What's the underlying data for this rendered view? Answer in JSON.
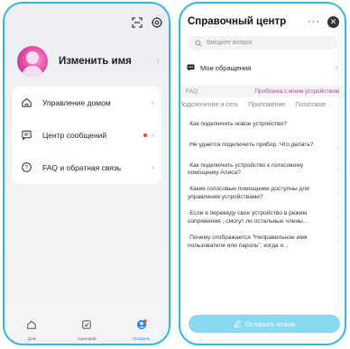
{
  "left": {
    "profile": {
      "name": "Изменить имя"
    },
    "menu": [
      {
        "label": "Управление домом",
        "icon": "home-icon"
      },
      {
        "label": "Центр сообщений",
        "icon": "message-icon",
        "badge": true
      },
      {
        "label": "FAQ и обратная связь",
        "icon": "help-icon"
      }
    ],
    "tabs": [
      {
        "label": "Дом",
        "icon": "home-tab-icon",
        "active": false
      },
      {
        "label": "Сценарий",
        "icon": "scenario-icon",
        "active": false
      },
      {
        "label": "Профиль",
        "icon": "profile-icon",
        "active": true
      }
    ]
  },
  "right": {
    "title": "Справочный центр",
    "more_glyph": "···",
    "search": {
      "placeholder": "Введите вопрос"
    },
    "requests_label": "Мои обращения",
    "faq": {
      "label": "FAQ",
      "link": "Проблема с моим устройством"
    },
    "categories": [
      "Подключение и сеть",
      "Приложение",
      "Голосовое"
    ],
    "questions": [
      "·Как подключить новое устройство?",
      "·Не удается подключить прибор. Что делать?",
      "·Как подключить устройство к голосовому помощнику Алиса?",
      "·Какие голосовые помощники доступны для управления устройствами?",
      "·Если я переведу свое устройство в режим сопряжения , смогут ли остальные члены...",
      "·Почему отображается \"Неправильное имя пользователя или пароль\", когда я..."
    ],
    "feedback_button": "Оставить отзыв"
  },
  "colors": {
    "accent": "#35b8d8",
    "button": "#88daf1",
    "badge": "#e5443a",
    "link": "#b53ea8"
  }
}
